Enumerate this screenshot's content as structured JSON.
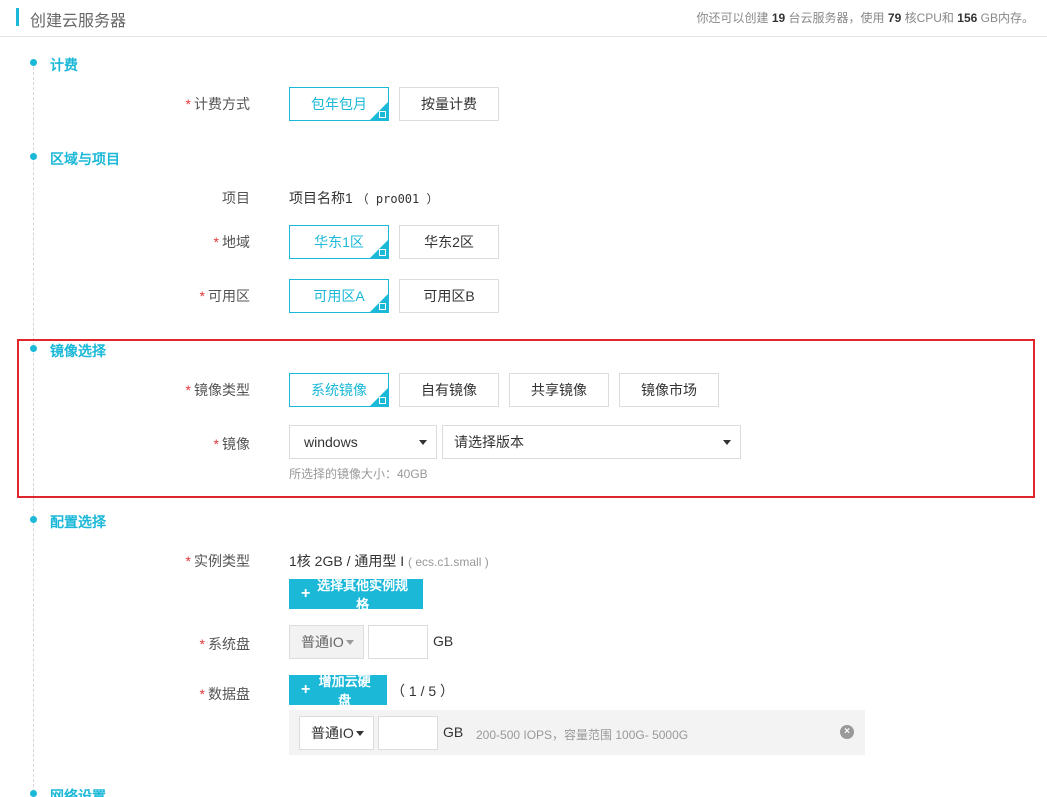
{
  "header": {
    "title": "创建云服务器",
    "quota_prefix": "你还可以创建",
    "quota_servers": "19",
    "quota_mid1": "台云服务器，使用",
    "quota_cpu": "79",
    "quota_mid2": "核CPU和",
    "quota_mem": "156",
    "quota_suffix": "GB内存。"
  },
  "billing": {
    "section_title": "计费",
    "mode_label": "计费方式",
    "options": [
      "包年包月",
      "按量计费"
    ],
    "selected": "包年包月"
  },
  "region": {
    "section_title": "区域与项目",
    "project_label": "项目",
    "project_name": "项目名称1",
    "project_code": "（ pro001 ）",
    "area_label": "地域",
    "area_options": [
      "华东1区",
      "华东2区"
    ],
    "zone_label": "可用区",
    "zone_options": [
      "可用区A",
      "可用区B"
    ]
  },
  "image": {
    "section_title": "镜像选择",
    "type_label": "镜像类型",
    "type_options": [
      "系统镜像",
      "自有镜像",
      "共享镜像",
      "镜像市场"
    ],
    "image_label": "镜像",
    "os_value": "windows",
    "version_placeholder": "请选择版本",
    "size_hint": "所选择的镜像大小：40GB"
  },
  "config": {
    "section_title": "配置选择",
    "instance_label": "实例类型",
    "instance_value": "1核 2GB / 通用型 I",
    "instance_code": "( ecs.c1.small )",
    "choose_spec_button": "选择其他实例规格",
    "system_disk_label": "系统盘",
    "system_disk_type": "普通IO",
    "gb_unit": "GB",
    "data_disk_label": "数据盘",
    "add_disk_button": "增加云硬盘",
    "disk_count": "（ 1 / 5 ）",
    "data_disk_type": "普通IO",
    "data_disk_hint": "200-500 IOPS，容量范围 100G- 5000G"
  },
  "network": {
    "section_title": "网络设置"
  },
  "colors": {
    "accent": "#1bb8d8",
    "required": "#e0373b",
    "highlight_border": "#e0262a"
  }
}
